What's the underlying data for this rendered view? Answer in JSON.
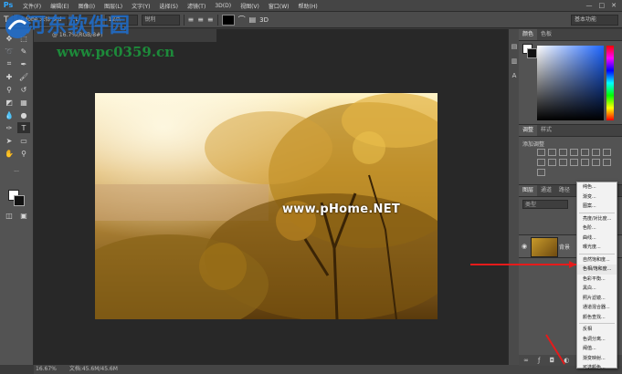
{
  "app": {
    "logo": "Ps",
    "menus": [
      "文件(F)",
      "编辑(E)",
      "图像(I)",
      "图层(L)",
      "文字(Y)",
      "选择(S)",
      "滤镜(T)",
      "3D(D)",
      "视图(V)",
      "窗口(W)",
      "帮助(H)"
    ],
    "window_controls": [
      "—",
      "□",
      "✕"
    ]
  },
  "options_bar": {
    "font_family": "Adobe 宋体 Std",
    "font_style": "L",
    "font_size": "12点",
    "antialias": "锐利",
    "workspace": "基本功能"
  },
  "document": {
    "tab_label": "@ 16.7%(RGB/8#)",
    "zoom": "16.67%",
    "doc_size": "文档:45.6M/45.6M"
  },
  "watermarks": {
    "site_name": "河东软件园",
    "site_url": "www.pc0359.cn",
    "pchome": "www.pHome.NET"
  },
  "panels": {
    "color_tabs": [
      "颜色",
      "色板"
    ],
    "adjust_tabs": [
      "调整",
      "样式"
    ],
    "adjust_title": "添加调整",
    "layer_tabs": [
      "图层",
      "通道",
      "路径"
    ],
    "layer_kind": "类型",
    "layer_name": "背景"
  },
  "dropdown": {
    "items": [
      "纯色...",
      "渐变...",
      "图案...",
      "亮度/对比度...",
      "色阶...",
      "曲线...",
      "曝光度...",
      "自然饱和度...",
      "色相/饱和度...",
      "色彩平衡...",
      "黑白...",
      "照片滤镜...",
      "通道混合器...",
      "颜色查找...",
      "反相",
      "色调分离...",
      "阈值...",
      "渐变映射...",
      "可选颜色..."
    ],
    "highlighted_index": 8
  },
  "colors": {
    "accent_arrow": "#e51b1b",
    "app_bg": "#535353",
    "canvas_bg": "#282828"
  }
}
